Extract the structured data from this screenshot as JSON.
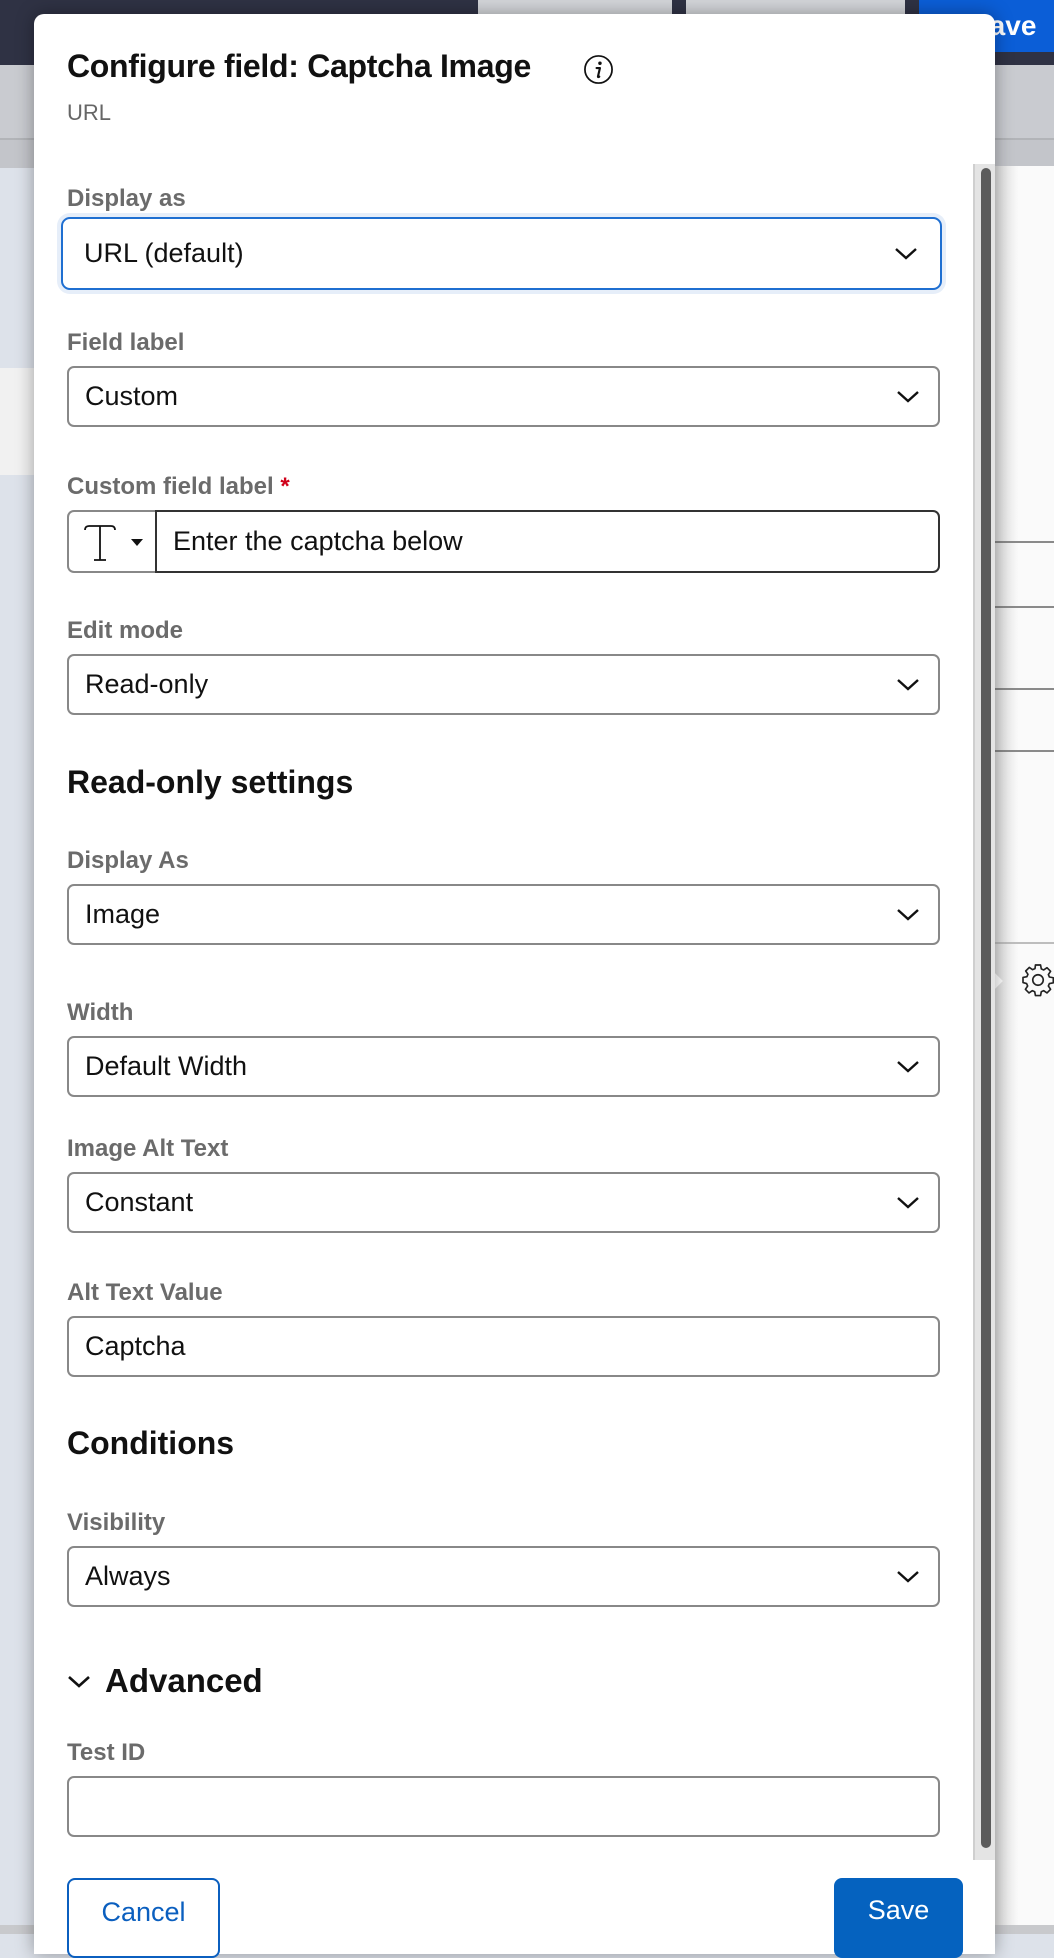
{
  "background": {
    "save_label": "Save",
    "accent": "#0b5ed7"
  },
  "modal": {
    "title": "Configure field: Captcha Image",
    "subtitle": "URL",
    "info_icon": "info-icon"
  },
  "fields": {
    "display_as": {
      "label": "Display as",
      "value": "URL (default)"
    },
    "field_label": {
      "label": "Field label",
      "value": "Custom"
    },
    "custom_field_label": {
      "label": "Custom field label",
      "required_mark": "*",
      "value": "Enter the captcha below",
      "prefix_icon": "text-type-icon"
    },
    "edit_mode": {
      "label": "Edit mode",
      "value": "Read-only"
    }
  },
  "read_only_settings": {
    "heading": "Read-only settings",
    "display_as": {
      "label": "Display As",
      "value": "Image"
    },
    "width": {
      "label": "Width",
      "value": "Default Width"
    },
    "image_alt_text": {
      "label": "Image Alt Text",
      "value": "Constant"
    },
    "alt_text_value": {
      "label": "Alt Text Value",
      "value": "Captcha"
    }
  },
  "conditions": {
    "heading": "Conditions",
    "visibility": {
      "label": "Visibility",
      "value": "Always"
    }
  },
  "advanced": {
    "heading": "Advanced",
    "test_id": {
      "label": "Test ID",
      "value": ""
    }
  },
  "footer": {
    "cancel_label": "Cancel",
    "save_label": "Save",
    "primary_color": "#0562bf"
  }
}
